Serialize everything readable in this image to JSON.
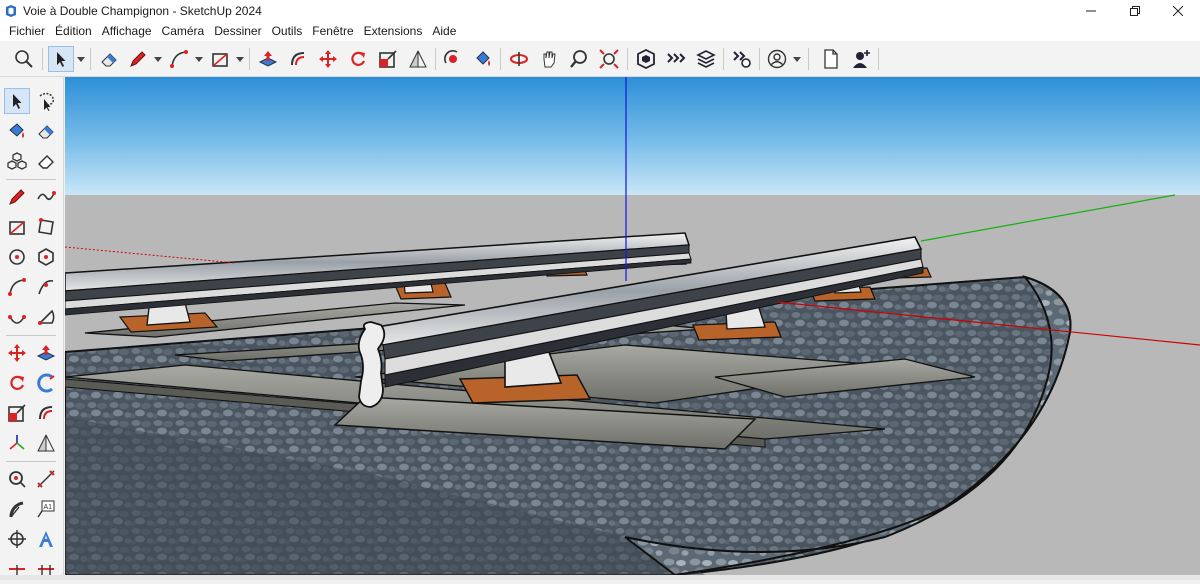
{
  "window": {
    "title": "Voie à Double Champignon - SketchUp 2024",
    "app_icon": "sketchup-logo-icon"
  },
  "menubar": {
    "items": [
      "Fichier",
      "Édition",
      "Affichage",
      "Caméra",
      "Dessiner",
      "Outils",
      "Fenêtre",
      "Extensions",
      "Aide"
    ]
  },
  "toolbar": {
    "tools": [
      "search-icon",
      "select-icon",
      "eraser-icon",
      "pencil-line-icon",
      "arc-icon",
      "rectangle-icon",
      "push-pull-icon",
      "offset-icon",
      "move-icon",
      "rotate-icon",
      "scale-icon",
      "section-plane-icon",
      "orbit-icon",
      "paint-bucket-icon",
      "position-camera-icon",
      "pan-icon",
      "zoom-icon",
      "zoom-extents-icon",
      "warehouse-icon",
      "extension-warehouse-icon",
      "layout-icon",
      "extension-manager-icon",
      "account-icon",
      "new-file-icon",
      "add-user-icon"
    ]
  },
  "left_toolbar": {
    "tools": [
      "select-icon",
      "lasso-icon",
      "paint-bucket-icon",
      "eraser-icon",
      "component-icon",
      "tag-eraser-icon",
      "pencil-line-icon",
      "freehand-icon",
      "rectangle-icon",
      "rotated-rectangle-icon",
      "circle-icon",
      "polygon-icon",
      "arc-icon",
      "two-point-arc-icon",
      "three-point-arc-icon",
      "pie-icon",
      "move-icon",
      "push-pull-icon",
      "rotate-icon",
      "follow-me-icon",
      "scale-icon",
      "offset-icon",
      "axes-icon",
      "section-plane-icon",
      "tape-measure-icon",
      "dimension-icon",
      "protractor-icon",
      "text-label-icon",
      "section-cut-icon",
      "3d-text-icon"
    ]
  },
  "colors": {
    "sky_top": "#2d8fd8",
    "sky_bottom": "#c9e6f7",
    "ground": "#b8b8b8",
    "axis_red": "#d00000",
    "axis_green": "#00b000",
    "axis_blue": "#0000e0",
    "active_tool": "#d6e6f6"
  }
}
